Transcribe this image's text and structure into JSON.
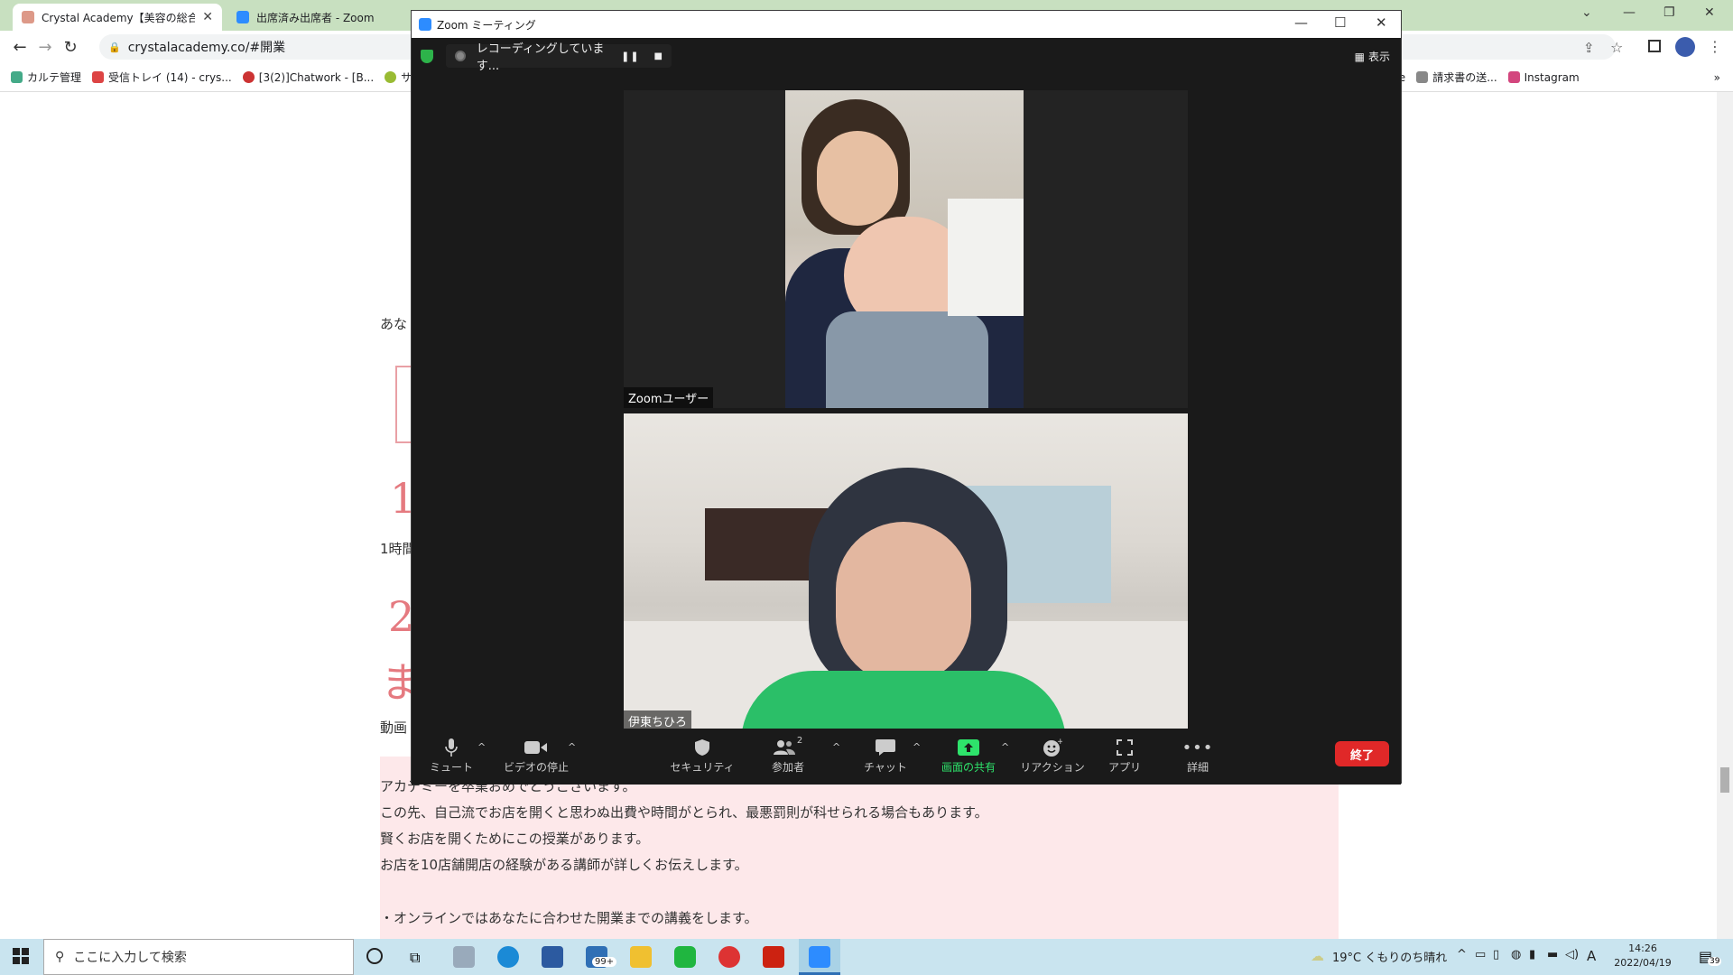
{
  "browser": {
    "tabs": [
      {
        "title": "Crystal Academy【美容の総合アカ",
        "active": true
      },
      {
        "title": "出席済み出席者 - Zoom",
        "active": false
      }
    ],
    "url": "crystalacademy.co/#開業",
    "bookmarks": [
      "カルテ管理",
      "受信トレイ (14) - crys...",
      "[3(2)]Chatwork - [B...",
      "サル",
      "pe",
      "請求書の送...",
      "Instagram"
    ]
  },
  "page": {
    "partial_lines": [
      "あな",
      "1",
      "1時間",
      "2",
      "ま",
      "動画"
    ],
    "paragraphs": [
      "アカデミーを卒業おめでとうございます。",
      "この先、自己流でお店を開くと思わぬ出費や時間がとられ、最悪罰則が科せられる場合もあります。",
      "賢くお店を開くためにこの授業があります。",
      "お店を10店舗開店の経験がある講師が詳しくお伝えします。",
      "",
      "・オンラインではあなたに合わせた開業までの講義をします。"
    ]
  },
  "zoom": {
    "window_title": "Zoom ミーティング",
    "recording_text": "レコーディングしています...",
    "view_label": "表示",
    "participants": [
      {
        "name": "Zoomユーザー"
      },
      {
        "name": "伊東ちひろ"
      }
    ],
    "controls": {
      "mute": "ミュート",
      "video": "ビデオの停止",
      "security": "セキュリティ",
      "participants": "参加者",
      "participant_count": "2",
      "chat": "チャット",
      "share": "画面の共有",
      "reactions": "リアクション",
      "apps": "アプリ",
      "more": "詳細",
      "end": "終了"
    }
  },
  "taskbar": {
    "search_placeholder": "ここに入力して検索",
    "mail_badge": "99+",
    "weather": "19°C くもりのち晴れ",
    "ime": "A",
    "time": "14:26",
    "date": "2022/04/19",
    "notification_count": "39"
  }
}
